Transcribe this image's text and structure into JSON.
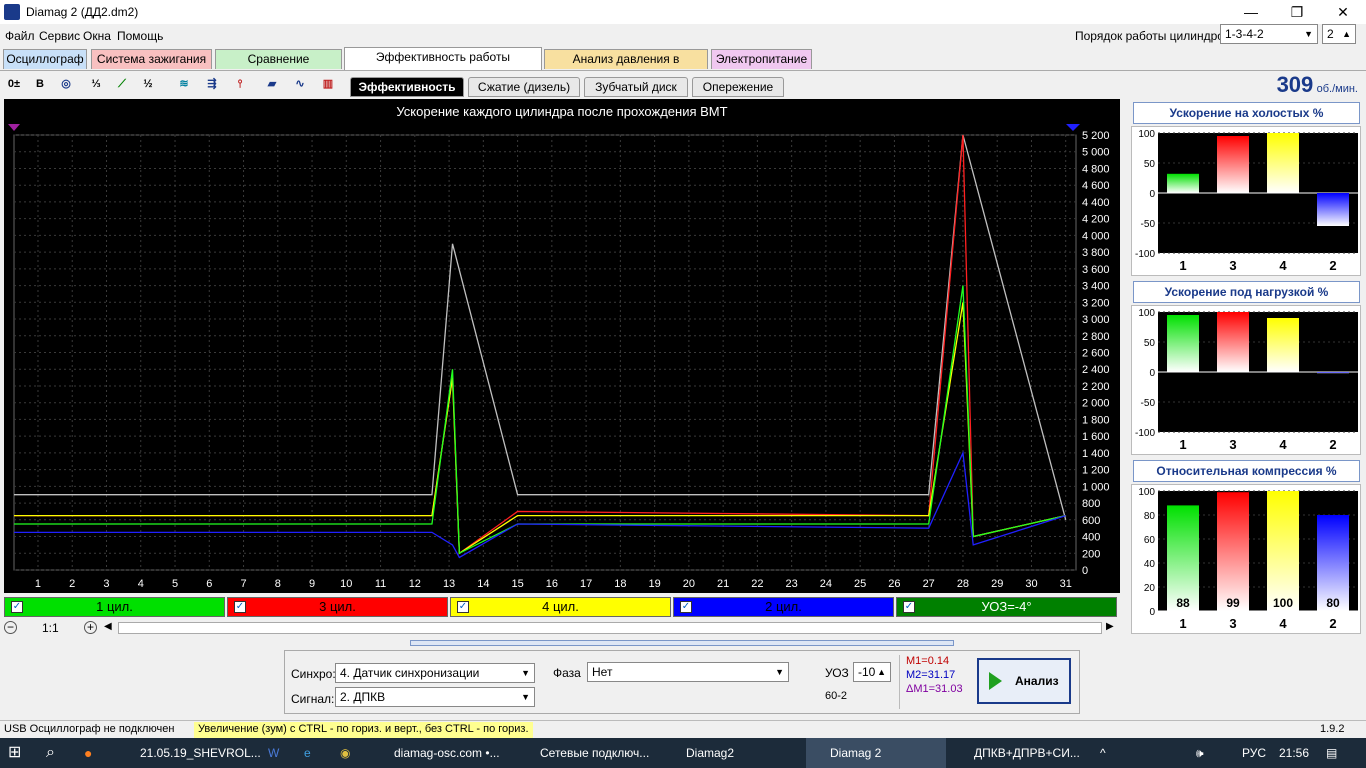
{
  "window": {
    "title": "Diamag 2 (ДД2.dm2)",
    "minimize": "—",
    "maximize": "❐",
    "close": "✕"
  },
  "menu": [
    "Файл",
    "Сервис",
    "Окна",
    "Помощь"
  ],
  "firing_order": {
    "label": "Порядок работы цилиндров",
    "value": "1-3-4-2",
    "count": "2"
  },
  "tabs": [
    {
      "label": "Осциллограф",
      "color": "#c8e0f8"
    },
    {
      "label": "Система зажигания",
      "color": "#f8c0c0"
    },
    {
      "label": "Сравнение цилиндров",
      "color": "#c8f0c8"
    },
    {
      "label": "Эффективность работы цилиндров",
      "color": "#ffffff"
    },
    {
      "label": "Анализ давления в цилиндре",
      "color": "#f8e0a0"
    },
    {
      "label": "Электропитание",
      "color": "#f0c8f0"
    }
  ],
  "subtabs": [
    "Эффективность",
    "Сжатие (дизель)",
    "Зубчатый диск",
    "Опережение"
  ],
  "rpm": {
    "value": "309",
    "unit": "об./мин."
  },
  "chart_data": {
    "type": "line",
    "title": "Ускорение каждого цилиндра после прохождения ВМТ",
    "x_ticks": [
      "1",
      "2",
      "3",
      "4",
      "5",
      "6",
      "7",
      "8",
      "9",
      "10",
      "11",
      "12",
      "13",
      "14",
      "15",
      "16",
      "17",
      "18",
      "19",
      "20",
      "21",
      "22",
      "23",
      "24",
      "25",
      "26",
      "27",
      "28",
      "29",
      "30",
      "31"
    ],
    "y_ticks": [
      "0",
      "200",
      "400",
      "600",
      "800",
      "1 000",
      "1 200",
      "1 400",
      "1 600",
      "1 800",
      "2 000",
      "2 200",
      "2 400",
      "2 600",
      "2 800",
      "3 000",
      "3 200",
      "3 400",
      "3 600",
      "3 800",
      "4 000",
      "4 200",
      "4 400",
      "4 600",
      "4 800",
      "5 000",
      "5 200"
    ],
    "ylim": [
      0,
      5200
    ],
    "xlim": [
      0.3,
      31.3
    ],
    "series": [
      {
        "color": "#c0c0c0",
        "values": [
          [
            0.3,
            900
          ],
          [
            12.5,
            900
          ],
          [
            13.1,
            3900
          ],
          [
            15,
            900
          ],
          [
            27,
            900
          ],
          [
            28,
            5200
          ],
          [
            31,
            600
          ]
        ]
      },
      {
        "color": "#ff2020",
        "values": [
          [
            0.3,
            650
          ],
          [
            12.5,
            650
          ],
          [
            13.1,
            2300
          ],
          [
            13.3,
            200
          ],
          [
            15,
            700
          ],
          [
            27,
            650
          ],
          [
            28,
            5200
          ],
          [
            28.3,
            400
          ],
          [
            31,
            650
          ]
        ]
      },
      {
        "color": "#ffff00",
        "values": [
          [
            0.3,
            650
          ],
          [
            12.5,
            650
          ],
          [
            13.1,
            2300
          ],
          [
            13.3,
            200
          ],
          [
            15,
            650
          ],
          [
            27,
            650
          ],
          [
            28,
            3200
          ],
          [
            28.3,
            400
          ],
          [
            31,
            650
          ]
        ]
      },
      {
        "color": "#20ff20",
        "values": [
          [
            0.3,
            550
          ],
          [
            12.5,
            550
          ],
          [
            13.1,
            2400
          ],
          [
            13.3,
            200
          ],
          [
            15,
            550
          ],
          [
            27,
            550
          ],
          [
            28,
            3400
          ],
          [
            28.3,
            400
          ],
          [
            31,
            650
          ]
        ]
      },
      {
        "color": "#2020ff",
        "values": [
          [
            0.3,
            450
          ],
          [
            12.5,
            450
          ],
          [
            13.1,
            300
          ],
          [
            13.3,
            150
          ],
          [
            15,
            550
          ],
          [
            27,
            500
          ],
          [
            28,
            1400
          ],
          [
            28.3,
            300
          ],
          [
            31,
            650
          ]
        ]
      }
    ],
    "grid": true
  },
  "cylinders": [
    {
      "label": "1 цил.",
      "color": "#00e000"
    },
    {
      "label": "3 цил.",
      "color": "#ff0000"
    },
    {
      "label": "4 цил.",
      "color": "#ffff00"
    },
    {
      "label": "2 цил.",
      "color": "#0000ff"
    },
    {
      "label": "УОЗ=-4°",
      "color": "#008000"
    }
  ],
  "zoom": "1:1",
  "panels": [
    {
      "title": "Ускорение на холостых %",
      "ticks": [
        "100",
        "50",
        "0",
        "-50",
        "-100"
      ],
      "ylim": [
        -100,
        100
      ],
      "categories": [
        "1",
        "3",
        "4",
        "2"
      ],
      "values": [
        32,
        95,
        100,
        -55
      ],
      "colors": [
        "#00e000",
        "#ff0000",
        "#ffff00",
        "#0000ff"
      ]
    },
    {
      "title": "Ускорение под нагрузкой %",
      "ticks": [
        "100",
        "50",
        "0",
        "-50",
        "-100"
      ],
      "ylim": [
        -100,
        100
      ],
      "categories": [
        "1",
        "3",
        "4",
        "2"
      ],
      "values": [
        95,
        100,
        90,
        -2
      ],
      "colors": [
        "#00e000",
        "#ff0000",
        "#ffff00",
        "#0000ff"
      ]
    },
    {
      "title": "Относительная компрессия %",
      "ticks": [
        "100",
        "80",
        "60",
        "40",
        "20",
        "0"
      ],
      "ylim": [
        0,
        100
      ],
      "categories": [
        "1",
        "3",
        "4",
        "2"
      ],
      "values": [
        88,
        99,
        100,
        80
      ],
      "labels": [
        "88",
        "99",
        "100",
        "80"
      ],
      "colors": [
        "#00e000",
        "#ff0000",
        "#ffff00",
        "#0000ff"
      ]
    }
  ],
  "controls": {
    "sync_label": "Синхро:",
    "sync_value": "4.  Датчик синхронизации",
    "signal_label": "Сигнал:",
    "signal_value": "2.  ДПКВ",
    "phase_label": "Фаза",
    "phase_value": "Нет",
    "uoz_label": "УОЗ",
    "uoz_value": "-10",
    "wheel": "60-2",
    "m1": "M1=0.14",
    "m2": "M2=31.17",
    "dm1": "ΔM1=31.03",
    "analyze": "Анализ"
  },
  "status": {
    "left": "USB Осциллограф не подключен",
    "hint": "Увеличение (зум) с CTRL - по гориз. и верт., без CTRL - по гориз.",
    "version": "1.9.2"
  },
  "taskbar": {
    "items": [
      "21.05.19_SHEVROL...",
      "diamag-osc.com •...",
      "Сетевые подключ...",
      "Diamag2",
      "Diamag 2",
      "ДПКВ+ДПРВ+СИ..."
    ],
    "lang": "РУС",
    "time": "21:56"
  }
}
